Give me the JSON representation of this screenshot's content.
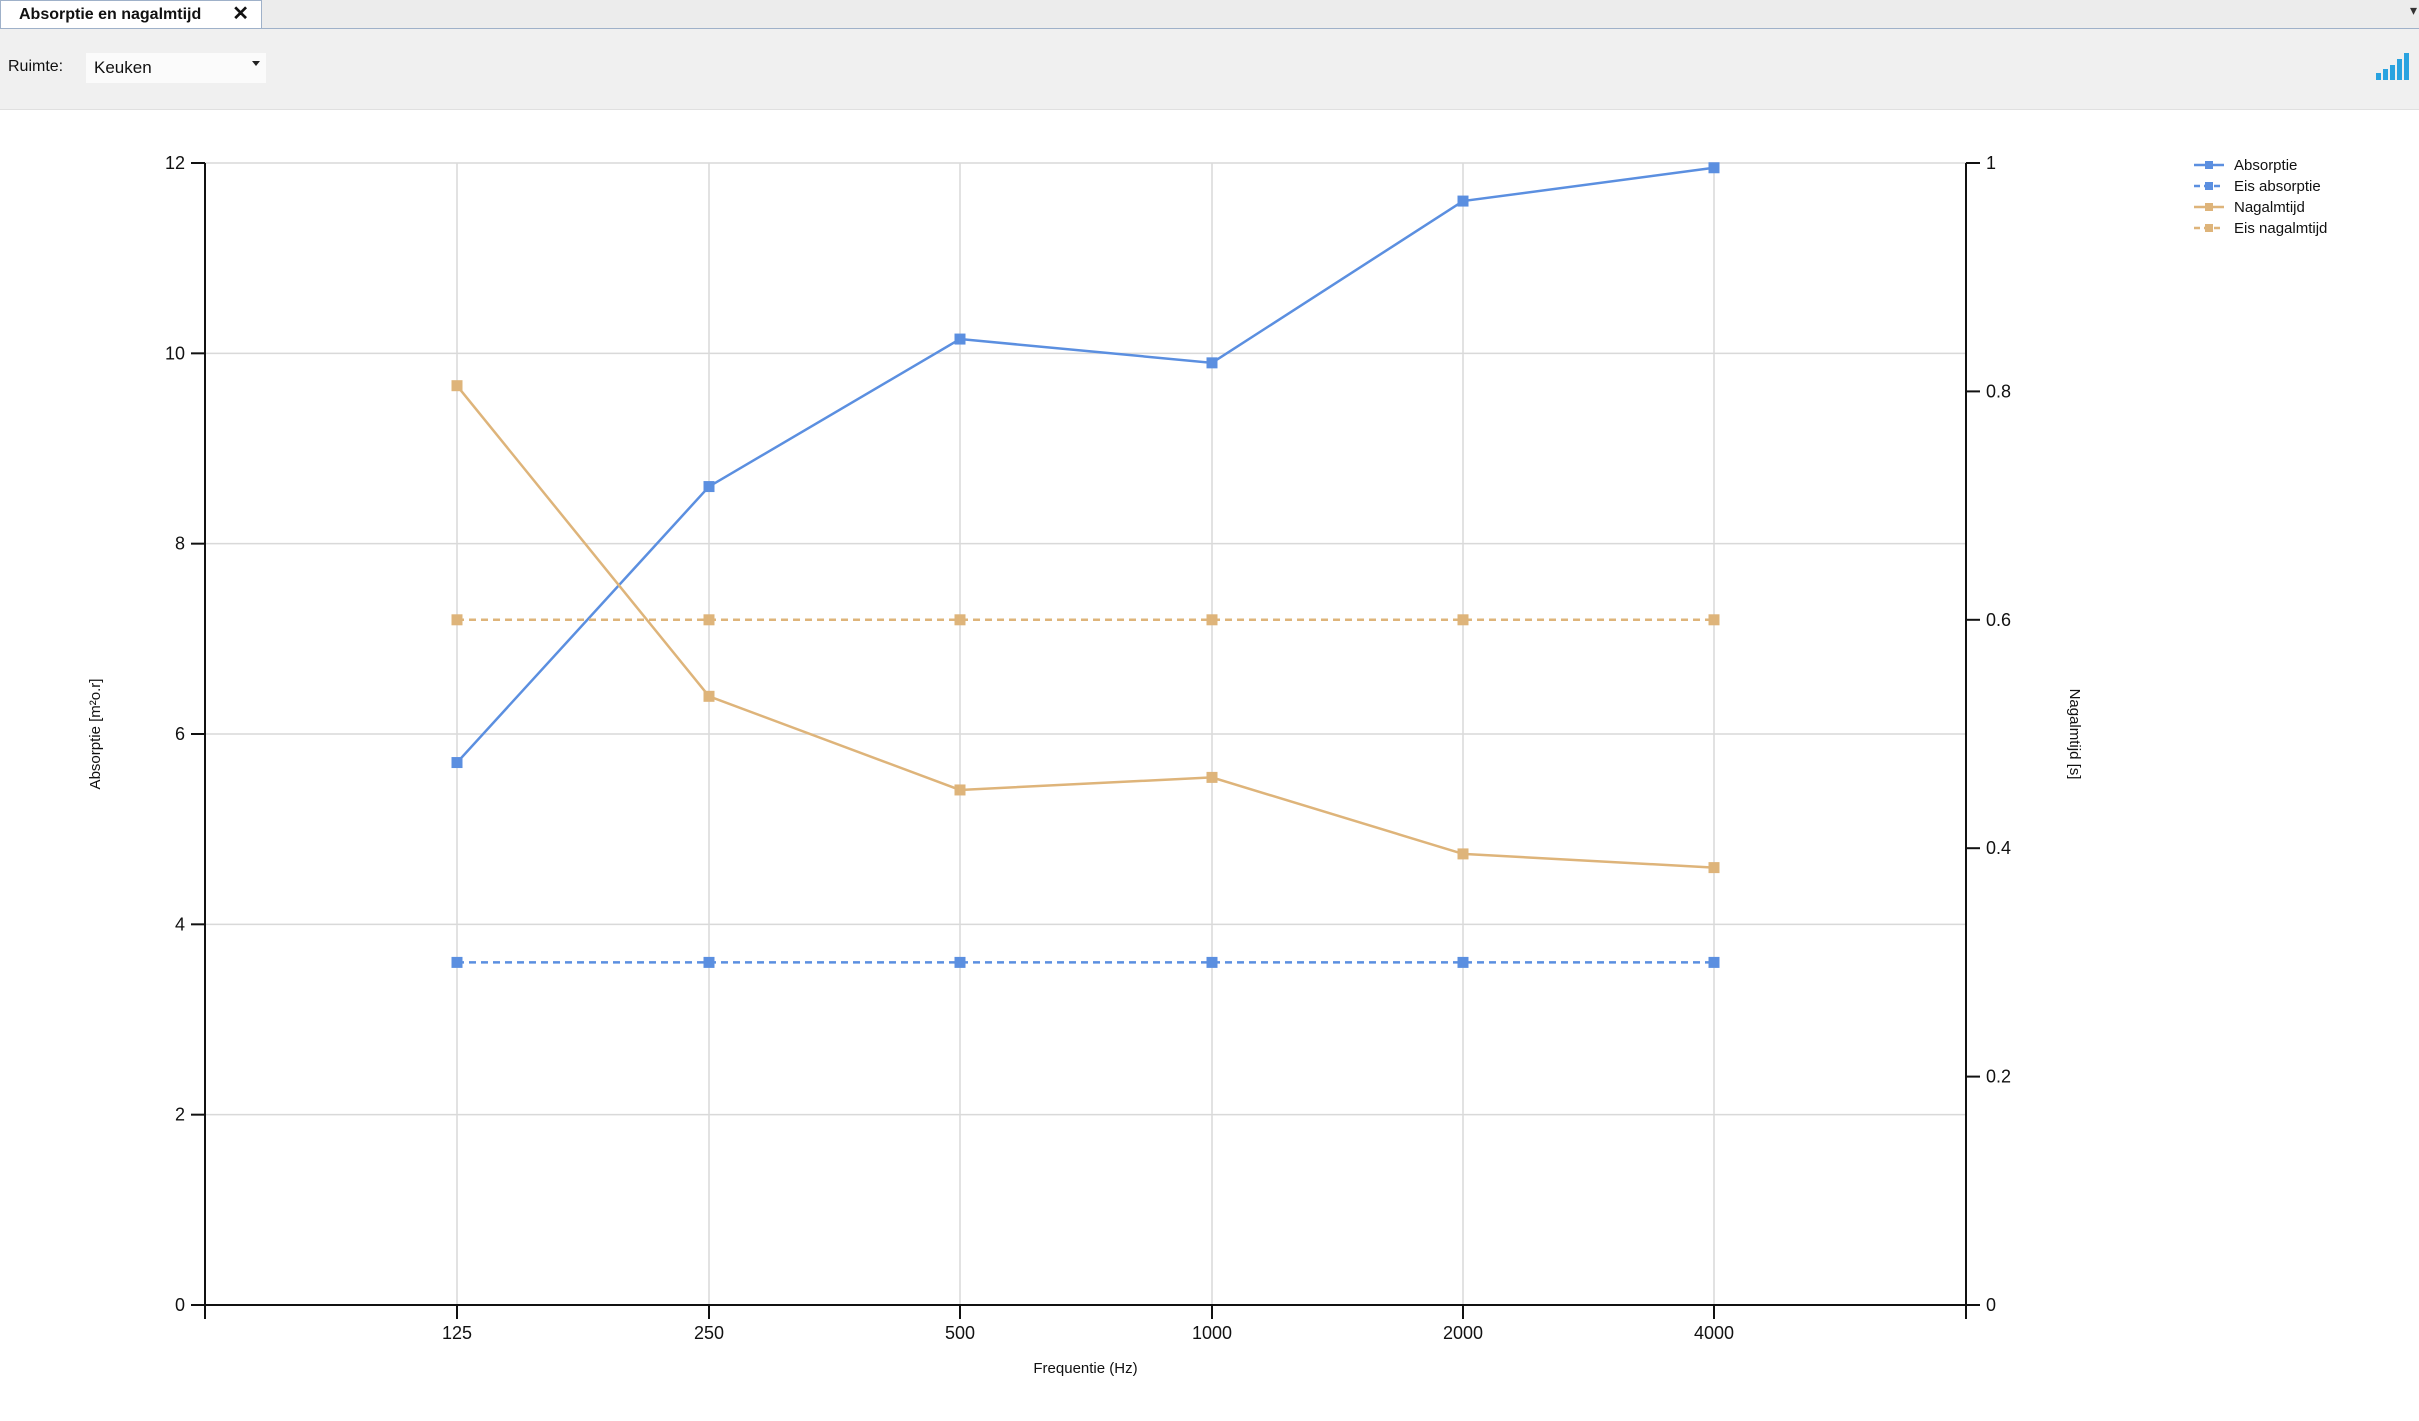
{
  "window": {
    "tab_label": "Absorptie en nagalmtijd",
    "tab_close": "✕"
  },
  "toolbar": {
    "ruimte_label": "Ruimte:",
    "ruimte_value": "Keuken",
    "chart_icon": "bar-chart-icon"
  },
  "colors": {
    "absorptie": "#5b8fe0",
    "nagalmtijd": "#deb47a",
    "grid": "#d9d9d9",
    "axis": "#111111"
  },
  "chart_data": {
    "type": "line",
    "x": [
      "125",
      "250",
      "500",
      "1000",
      "2000",
      "4000"
    ],
    "xlabel": "Frequentie (Hz)",
    "ylabel_left": "Absorptie [m²o.r]",
    "ylabel_right": "Nagalmtijd [s]",
    "ylim_left": [
      0,
      12
    ],
    "ylim_right": [
      0,
      1
    ],
    "yticks_left": [
      "0",
      "2",
      "4",
      "6",
      "8",
      "10",
      "12"
    ],
    "yticks_right": [
      "0",
      "0.2",
      "0.4",
      "0.6",
      "0.8",
      "1"
    ],
    "grid": true,
    "legend_position": "top-right",
    "series": [
      {
        "name": "Absorptie",
        "axis": "left",
        "style": "solid",
        "color": "#5b8fe0",
        "values": [
          5.7,
          8.6,
          10.15,
          9.9,
          11.6,
          11.95
        ]
      },
      {
        "name": "Eis absorptie",
        "axis": "left",
        "style": "dashed",
        "color": "#5b8fe0",
        "values": [
          3.6,
          3.6,
          3.6,
          3.6,
          3.6,
          3.6
        ]
      },
      {
        "name": "Nagalmtijd",
        "axis": "right",
        "style": "solid",
        "color": "#deb47a",
        "values": [
          0.805,
          0.533,
          0.451,
          0.462,
          0.395,
          0.383
        ]
      },
      {
        "name": "Eis nagalmtijd",
        "axis": "right",
        "style": "dashed",
        "color": "#deb47a",
        "values": [
          0.6,
          0.6,
          0.6,
          0.6,
          0.6,
          0.6
        ]
      }
    ]
  }
}
